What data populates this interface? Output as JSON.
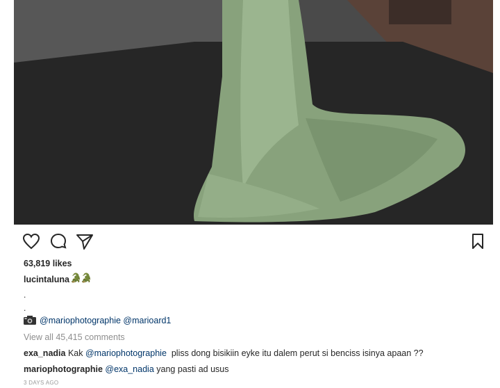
{
  "post": {
    "likes_text": "63,819 likes",
    "caption_user": "lucintaluna",
    "caption_emoji": "🐊🐊",
    "caption_dots": [
      ".",
      "."
    ],
    "camera_icon": "camera-icon",
    "mention_1": "@mariophotographie",
    "mention_2": "@marioard1",
    "view_all": "View all 45,415 comments",
    "timestamp": "3 DAYS AGO"
  },
  "comments": [
    {
      "user": "exa_nadia",
      "prefix": "Kak ",
      "mention": "@mariophotographie",
      "text": "  pliss dong bisikiin eyke itu dalem perut si benciss isinya apaan ??"
    },
    {
      "user": "mariophotographie",
      "prefix": "",
      "mention": "@exa_nadia",
      "text": " yang pasti ad usus"
    }
  ],
  "icons": {
    "like": "heart-icon",
    "comment": "comment-bubble-icon",
    "share": "paper-plane-icon",
    "save": "bookmark-icon"
  },
  "colors": {
    "link": "#003569",
    "muted": "#8e8e8e",
    "text": "#262626",
    "gown": "#8aa57f"
  }
}
